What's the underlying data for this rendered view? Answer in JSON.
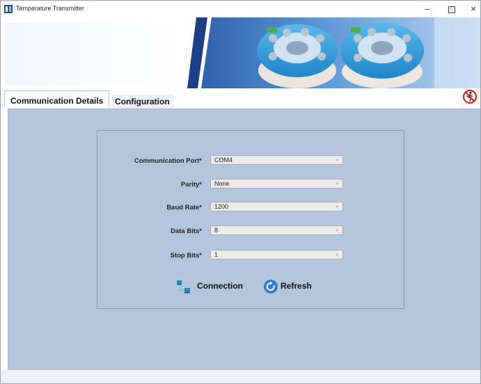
{
  "window": {
    "title": "Temperature Transmitter",
    "controls": {
      "minimize": "–",
      "maximize": "□",
      "close": "×"
    }
  },
  "tabs": [
    {
      "label": "Communication Details",
      "active": true
    },
    {
      "label": "Configuration",
      "active": false
    }
  ],
  "form": {
    "fields": [
      {
        "label": "Communication Port*",
        "value": "COM4"
      },
      {
        "label": "Parity*",
        "value": "None"
      },
      {
        "label": "Baud Rate*",
        "value": "1200"
      },
      {
        "label": "Data Bits*",
        "value": "8"
      },
      {
        "label": "Stop Bits*",
        "value": "1"
      }
    ]
  },
  "buttons": {
    "connection": "Connection",
    "refresh": "Refresh"
  },
  "icons": {
    "app": "app-logo-icon",
    "exit": "exit-icon",
    "connection": "network-connection-icon",
    "refresh": "refresh-icon",
    "dropdown": "chevron-down-icon"
  },
  "colors": {
    "content_bg": "#b3c6dc",
    "accent_blue": "#2d7dd2",
    "exit_red": "#d42a2a",
    "connection_teal": "#1d8fb0"
  }
}
